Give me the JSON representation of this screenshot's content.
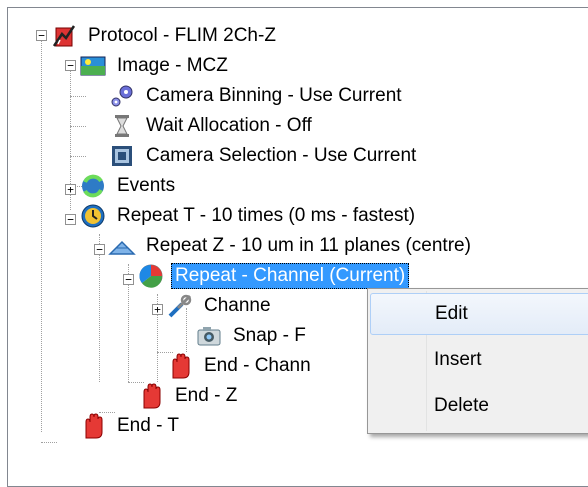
{
  "tree": {
    "nodes": [
      {
        "label": "Protocol - FLIM 2Ch-Z",
        "icon": "protocol-icon",
        "expander": "−"
      },
      {
        "label": "Image - MCZ",
        "icon": "image-icon",
        "expander": "−"
      },
      {
        "label": "Camera Binning - Use Current",
        "icon": "gear-icon"
      },
      {
        "label": "Wait Allocation - Off",
        "icon": "hourglass-icon"
      },
      {
        "label": "Camera Selection - Use Current",
        "icon": "camera-selection-icon"
      },
      {
        "label": "Events",
        "icon": "events-icon",
        "expander": "+"
      },
      {
        "label": "Repeat T - 10 times (0 ms - fastest)",
        "icon": "clock-icon",
        "expander": "−"
      },
      {
        "label": "Repeat Z - 10 um in 11 planes (centre)",
        "icon": "z-stack-icon",
        "expander": "−"
      },
      {
        "label": "Repeat - Channel (Current)",
        "icon": "channel-icon",
        "expander": "−",
        "selected": true
      },
      {
        "label": "Channe",
        "icon": "tools-icon",
        "expander": "+"
      },
      {
        "label": "Snap - F",
        "icon": "snap-camera-icon"
      },
      {
        "label": "End - Chann",
        "icon": "stop-hand-icon"
      },
      {
        "label": "End - Z",
        "icon": "stop-hand-icon"
      },
      {
        "label": "End - T",
        "icon": "stop-hand-icon"
      }
    ]
  },
  "context_menu": {
    "items": [
      {
        "label": "Edit",
        "highlighted": true
      },
      {
        "label": "Insert"
      },
      {
        "label": "Delete"
      }
    ]
  }
}
